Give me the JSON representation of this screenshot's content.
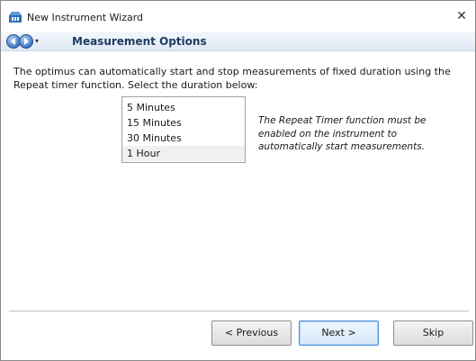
{
  "window": {
    "title": "New Instrument Wizard",
    "close_label": "✕"
  },
  "navbar": {
    "dropdown_glyph": "▾",
    "page_title": "Measurement Options"
  },
  "content": {
    "instructions": "The optimus can automatically start and stop measurements of fixed duration using the Repeat timer function. Select the duration below:",
    "duration_options": [
      {
        "label": "5 Minutes",
        "selected": false
      },
      {
        "label": "15 Minutes",
        "selected": false
      },
      {
        "label": "30 Minutes",
        "selected": false
      },
      {
        "label": "1 Hour",
        "selected": true
      }
    ],
    "note": "The Repeat Timer function must be enabled on the instrument to automatically start measurements."
  },
  "footer": {
    "previous_label": "< Previous",
    "next_label": "Next >",
    "skip_label": "Skip"
  },
  "colors": {
    "accent": "#3d78c4",
    "title_text": "#1e3a5f",
    "nav_bg": "#dfe9f5"
  }
}
